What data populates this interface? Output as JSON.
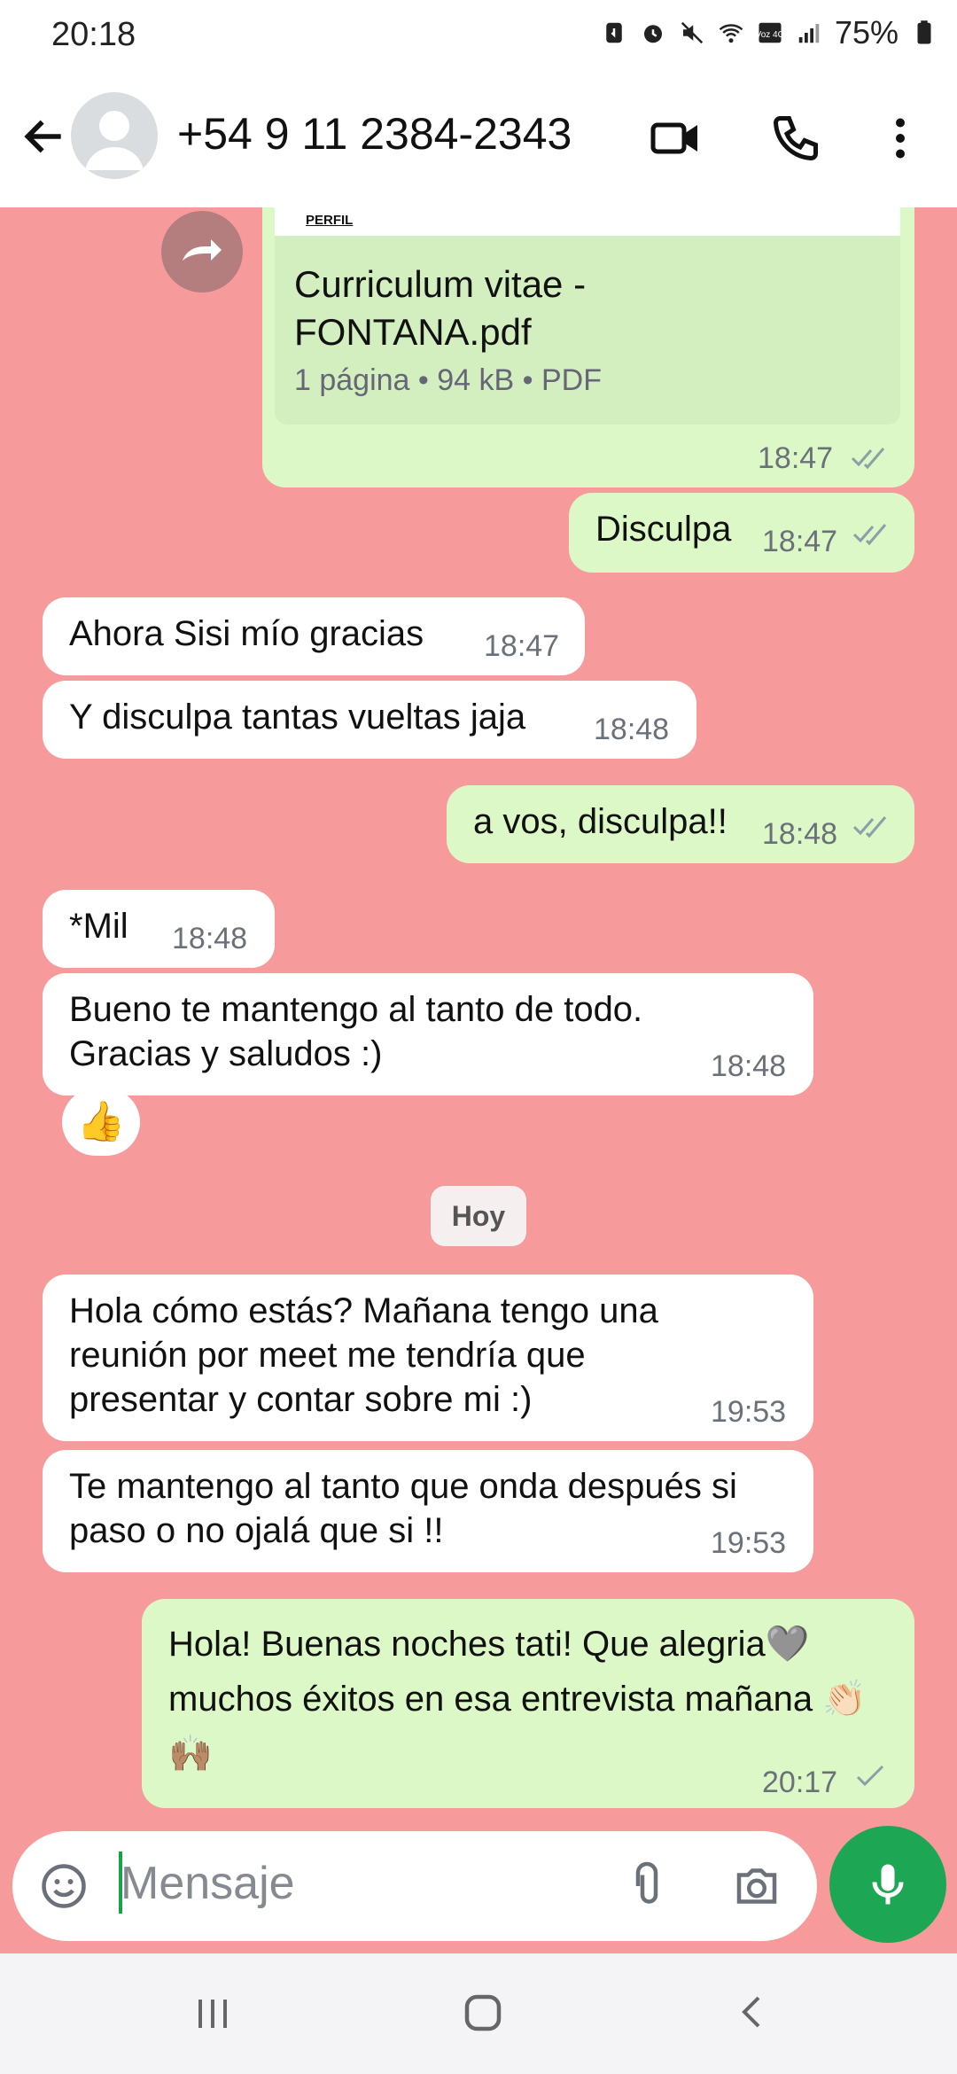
{
  "status_bar": {
    "time": "20:18",
    "battery": "75%",
    "network_badge": "Voz 4G",
    "icons": [
      "sim-icon",
      "alarm-icon",
      "mute-icon",
      "wifi-icon",
      "volte-icon",
      "signal-icon",
      "battery-icon"
    ]
  },
  "header": {
    "contact": "+54 9 11 2384-2343",
    "icons": [
      "back-arrow-icon",
      "avatar-icon",
      "video-call-icon",
      "phone-icon",
      "more-vert-icon"
    ]
  },
  "chat": {
    "attachment": {
      "header_label": "PERFIL",
      "file_name": "Curriculum vitae - FONTANA.pdf",
      "meta": "1 página • 94 kB • PDF",
      "time": "18:47"
    },
    "messages": [
      {
        "dir": "out",
        "text": "Disculpa",
        "time": "18:47",
        "status": "read"
      },
      {
        "dir": "in",
        "text": "Ahora Sisi mío gracias",
        "time": "18:47"
      },
      {
        "dir": "in",
        "text": "Y disculpa tantas vueltas jaja",
        "time": "18:48"
      },
      {
        "dir": "out",
        "text": "a vos, disculpa!!",
        "time": "18:48",
        "status": "read"
      },
      {
        "dir": "in",
        "text": "*Mil",
        "time": "18:48"
      },
      {
        "dir": "in",
        "text": "Bueno te mantengo al tanto de todo. Gracias y saludos :)",
        "time": "18:48",
        "reaction": "👍"
      },
      {
        "dir": "in",
        "text": "Hola cómo estás? Mañana tengo una reunión por meet me tendría que presentar y contar sobre mi :)",
        "time": "19:53"
      },
      {
        "dir": "in",
        "text": "Te mantengo al tanto que onda después si paso o no ojalá que si !!",
        "time": "19:53"
      },
      {
        "dir": "out",
        "text": "Hola! Buenas noches tati! Que alegria🩶 muchos éxitos en esa entrevista mañana 👏🏻🙌🏽",
        "time": "20:17",
        "status": "sent"
      }
    ],
    "day_separator": "Hoy"
  },
  "composer": {
    "placeholder": "Mensaje",
    "icons": [
      "emoji-icon",
      "attach-icon",
      "camera-icon",
      "mic-icon"
    ]
  },
  "colors": {
    "chat_bg": "#f69a9b",
    "incoming": "#ffffff",
    "outgoing": "#dcf8c6",
    "mic_button": "#1da653"
  }
}
